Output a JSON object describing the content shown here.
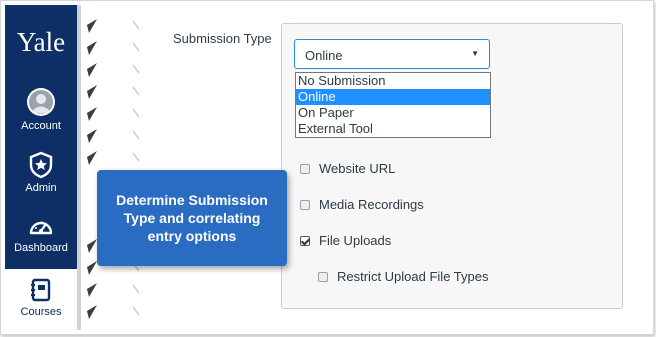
{
  "nav": {
    "logo": "Yale",
    "items": [
      {
        "label": "Account",
        "icon": "account-icon"
      },
      {
        "label": "Admin",
        "icon": "admin-shield-icon"
      },
      {
        "label": "Dashboard",
        "icon": "dashboard-gauge-icon"
      },
      {
        "label": "Courses",
        "icon": "courses-book-icon",
        "active": true
      }
    ]
  },
  "submission": {
    "label": "Submission Type",
    "selected": "Online",
    "options": [
      "No Submission",
      "Online",
      "On Paper",
      "External Tool"
    ]
  },
  "entry_options": [
    {
      "label": "Website URL",
      "checked": false
    },
    {
      "label": "Media Recordings",
      "checked": false
    },
    {
      "label": "File Uploads",
      "checked": true
    },
    {
      "label": "Restrict Upload File Types",
      "checked": false
    }
  ],
  "callout": "Determine Submission Type and correlating entry options",
  "colors": {
    "nav": "#0d2f66",
    "callout": "#2a6cc2",
    "selected_option": "#1e90ff"
  }
}
